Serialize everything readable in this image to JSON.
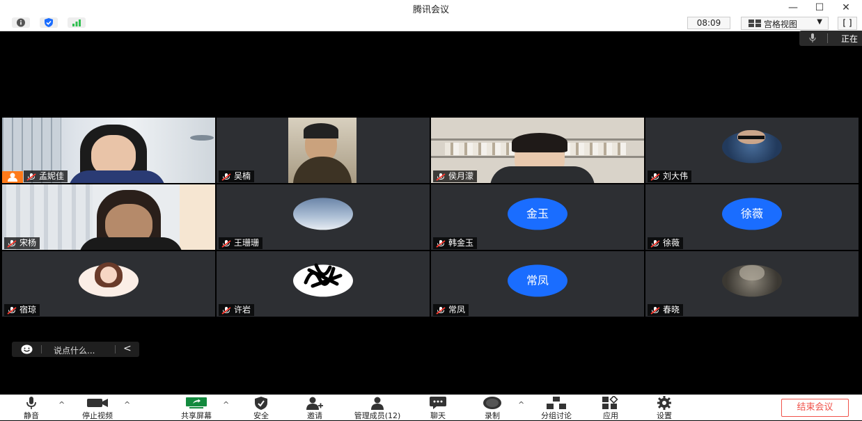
{
  "window": {
    "title": "腾讯会议",
    "minimize_label": "—",
    "maximize_label": "☐",
    "close_label": "✕"
  },
  "toolbar": {
    "timer": "08:09",
    "view_label": "宫格视图",
    "fullscreen_label": "[ ]"
  },
  "speaking": {
    "text": "正在"
  },
  "participants": [
    {
      "name": "孟妮佳",
      "tile": "video"
    },
    {
      "name": "吴楠",
      "tile": "video"
    },
    {
      "name": "侯月濛",
      "tile": "video"
    },
    {
      "name": "刘大伟",
      "tile": "avatar"
    },
    {
      "name": "宋杨",
      "tile": "video"
    },
    {
      "name": "王珊珊",
      "tile": "avatar"
    },
    {
      "name": "韩金玉",
      "tile": "name_avatar",
      "avatar_text": "金玉"
    },
    {
      "name": "徐薇",
      "tile": "name_avatar",
      "avatar_text": "徐薇"
    },
    {
      "name": "宿琼",
      "tile": "avatar"
    },
    {
      "name": "许岩",
      "tile": "avatar"
    },
    {
      "name": "常凤",
      "tile": "name_avatar",
      "avatar_text": "常凤"
    },
    {
      "name": "春晓",
      "tile": "avatar"
    }
  ],
  "chat": {
    "placeholder": "说点什么...",
    "collapse_label": "<"
  },
  "bottom_bar": {
    "mute": "静音",
    "stop_video": "停止视频",
    "share_screen": "共享屏幕",
    "security": "安全",
    "invite": "邀请",
    "manage_members": "管理成员(12)",
    "chat": "聊天",
    "record": "录制",
    "breakout": "分组讨论",
    "apps": "应用",
    "settings": "设置",
    "end_meeting": "结束会议",
    "caret": "^"
  },
  "colors": {
    "accent_blue": "#1a6dff",
    "end_red": "#f0524a",
    "signal_green": "#2fbf4f"
  }
}
